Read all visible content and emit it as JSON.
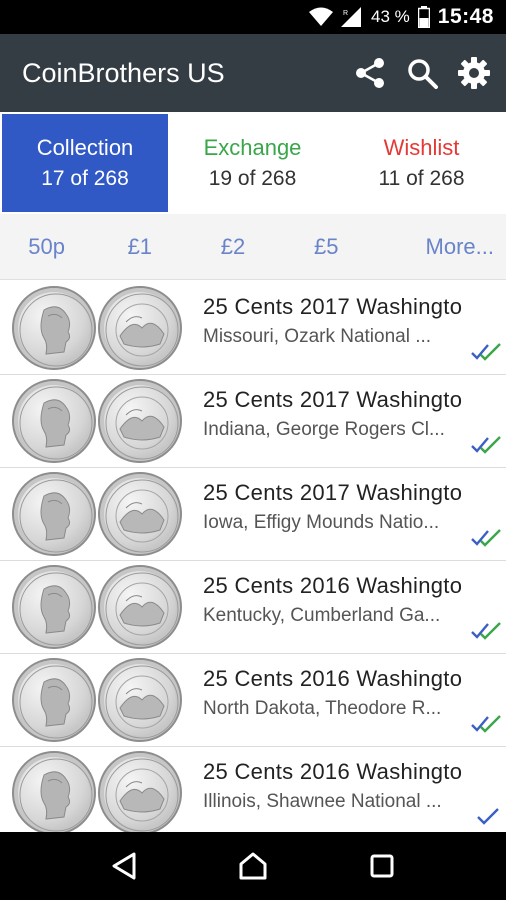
{
  "status_bar": {
    "battery_percent": "43 %",
    "time": "15:48",
    "icons": [
      "wifi-icon",
      "signal-icon",
      "battery-icon"
    ]
  },
  "app_bar": {
    "title": "CoinBrothers US",
    "actions": [
      "share-icon",
      "search-icon",
      "settings-icon"
    ]
  },
  "tabs": [
    {
      "label": "Collection",
      "count": "17 of 268",
      "color": "#ffffff",
      "active": true
    },
    {
      "label": "Exchange",
      "count": "19 of 268",
      "color": "#3aa64a",
      "active": false
    },
    {
      "label": "Wishlist",
      "count": "11 of 268",
      "color": "#e53935",
      "active": false
    }
  ],
  "filters": [
    "50p",
    "£1",
    "£2",
    "£5",
    "More..."
  ],
  "coins": [
    {
      "title": "25 Cents 2017 Washingto",
      "subtitle": "Missouri, Ozark National ...",
      "marks": "double"
    },
    {
      "title": "25 Cents 2017 Washingto",
      "subtitle": "Indiana, George Rogers Cl...",
      "marks": "double"
    },
    {
      "title": "25 Cents 2017 Washingto",
      "subtitle": "Iowa, Effigy Mounds Natio...",
      "marks": "double"
    },
    {
      "title": "25 Cents 2016 Washingto",
      "subtitle": "Kentucky, Cumberland Ga...",
      "marks": "double"
    },
    {
      "title": "25 Cents 2016 Washingto",
      "subtitle": "North Dakota, Theodore R...",
      "marks": "double"
    },
    {
      "title": "25 Cents 2016 Washingto",
      "subtitle": "Illinois, Shawnee National ...",
      "marks": "single"
    }
  ],
  "colors": {
    "app_bar": "#343d43",
    "active_tab": "#3159c5",
    "filter_text": "#6a84c9",
    "check_blue": "#3b5fc4",
    "check_green": "#3aa64a"
  },
  "nav_bar": [
    "back-icon",
    "home-icon",
    "recents-icon"
  ]
}
